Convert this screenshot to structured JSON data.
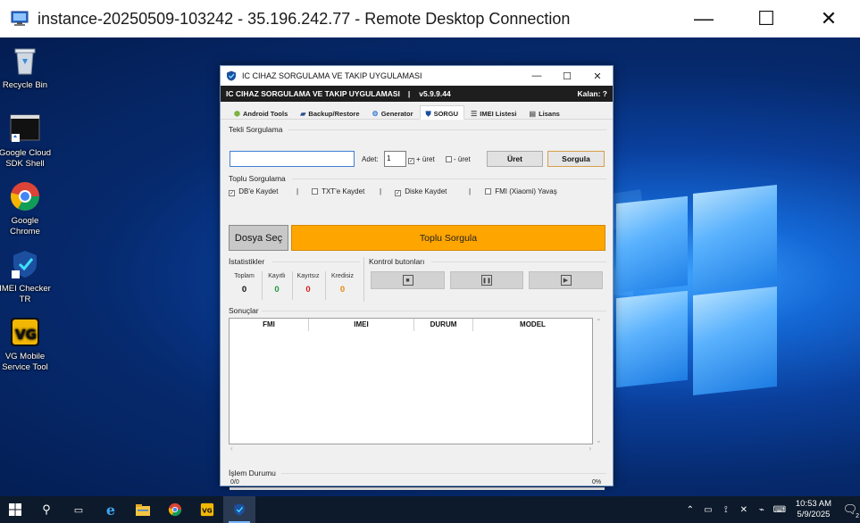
{
  "rdp": {
    "title": "instance-20250509-103242 - 35.196.242.77 - Remote Desktop Connection",
    "minimize": "—",
    "maximize": "☐",
    "close": "✕"
  },
  "desktop_icons": [
    {
      "label": "Recycle Bin",
      "icon": "recycle-bin-icon"
    },
    {
      "label": "Google Cloud SDK Shell",
      "icon": "terminal-icon"
    },
    {
      "label": "Google Chrome",
      "icon": "chrome-icon"
    },
    {
      "label": "IMEI Checker TR",
      "icon": "imei-checker-icon"
    },
    {
      "label": "VG Mobile Service Tool",
      "icon": "vg-icon"
    }
  ],
  "app": {
    "title": "IC CIHAZ SORGULAMA VE TAKIP UYGULAMASI",
    "header_title": "IC CIHAZ SORGULAMA VE TAKIP UYGULAMASI",
    "header_sep": "|",
    "version": "v5.9.9.44",
    "kalan": "Kalan: ?",
    "tabs": [
      {
        "label": "Android Tools",
        "icon": "android-icon",
        "active": false
      },
      {
        "label": "Backup/Restore",
        "icon": "backup-icon",
        "active": false
      },
      {
        "label": "Generator",
        "icon": "generator-icon",
        "active": false
      },
      {
        "label": "SORGU",
        "icon": "shield-icon",
        "active": true
      },
      {
        "label": "IMEI Listesi",
        "icon": "list-icon",
        "active": false
      },
      {
        "label": "Lisans",
        "icon": "license-icon",
        "active": false
      }
    ],
    "tekli": {
      "section": "Tekli Sorgulama",
      "input_value": "",
      "adet_label": "Adet:",
      "adet_value": "1",
      "plus_label": "+ üret",
      "minus_label": "- üret",
      "uret_button": "Üret",
      "sorgula_button": "Sorgula"
    },
    "toplu": {
      "section": "Toplu Sorgulama",
      "options": [
        {
          "label": "DB'e Kaydet",
          "checked": true
        },
        {
          "label": "TXT'e Kaydet",
          "checked": false
        },
        {
          "label": "Diske Kaydet",
          "checked": true
        },
        {
          "label": "FMI (Xiaomi) Yavaş",
          "checked": false
        }
      ],
      "separator": "|",
      "dosya_button": "Dosya Seç",
      "toplu_button": "Toplu Sorgula"
    },
    "istatistikler": {
      "section": "İstatistikler",
      "items": [
        {
          "label": "Toplam",
          "value": "0",
          "color": "#111111"
        },
        {
          "label": "Kayıtlı",
          "value": "0",
          "color": "#1f9a3a"
        },
        {
          "label": "Kayıtsız",
          "value": "0",
          "color": "#d42020"
        },
        {
          "label": "Kredisiz",
          "value": "0",
          "color": "#e8890c"
        }
      ]
    },
    "kontrol": {
      "section": "Kontrol butonları",
      "buttons": [
        {
          "name": "stop",
          "glyph": "■"
        },
        {
          "name": "pause",
          "glyph": "❚❚"
        },
        {
          "name": "play",
          "glyph": "▶"
        }
      ]
    },
    "sonuclar": {
      "section": "Sonuçlar",
      "columns": [
        "FMI",
        "IMEI",
        "DURUM",
        "MODEL"
      ],
      "rows": []
    },
    "islem": {
      "section": "İşlem Durumu",
      "left": "0/0",
      "right": "0%",
      "progress": 0
    }
  },
  "taskbar": {
    "clock_time": "10:53 AM",
    "clock_date": "5/9/2025",
    "notifications": "2"
  }
}
